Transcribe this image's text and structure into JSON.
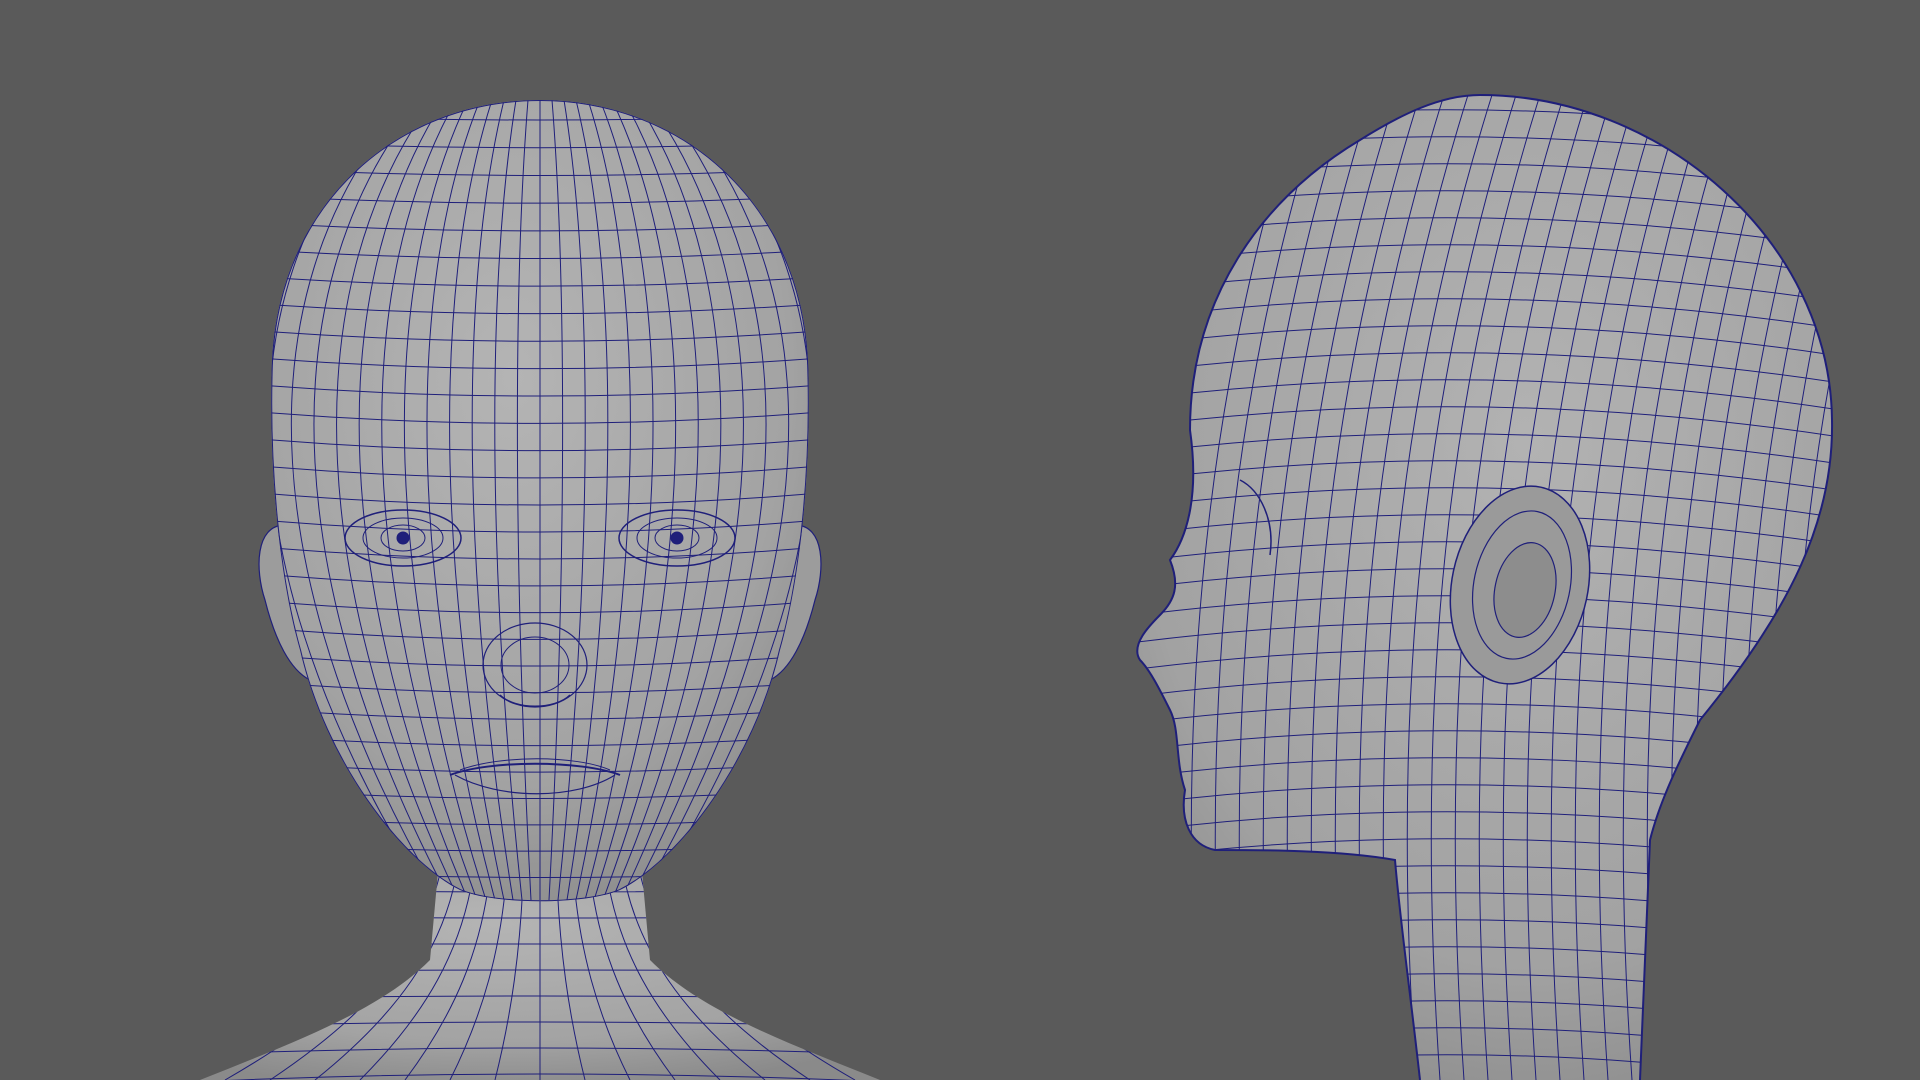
{
  "viewport": {
    "background": "#5a5a5a",
    "mesh_fill": "#a7a7a7",
    "mesh_shade": "#8e8e8e",
    "wire_color": "#1f1f7a"
  },
  "panels": [
    {
      "id": "front",
      "view": "front"
    },
    {
      "id": "side",
      "view": "side-profile"
    }
  ]
}
